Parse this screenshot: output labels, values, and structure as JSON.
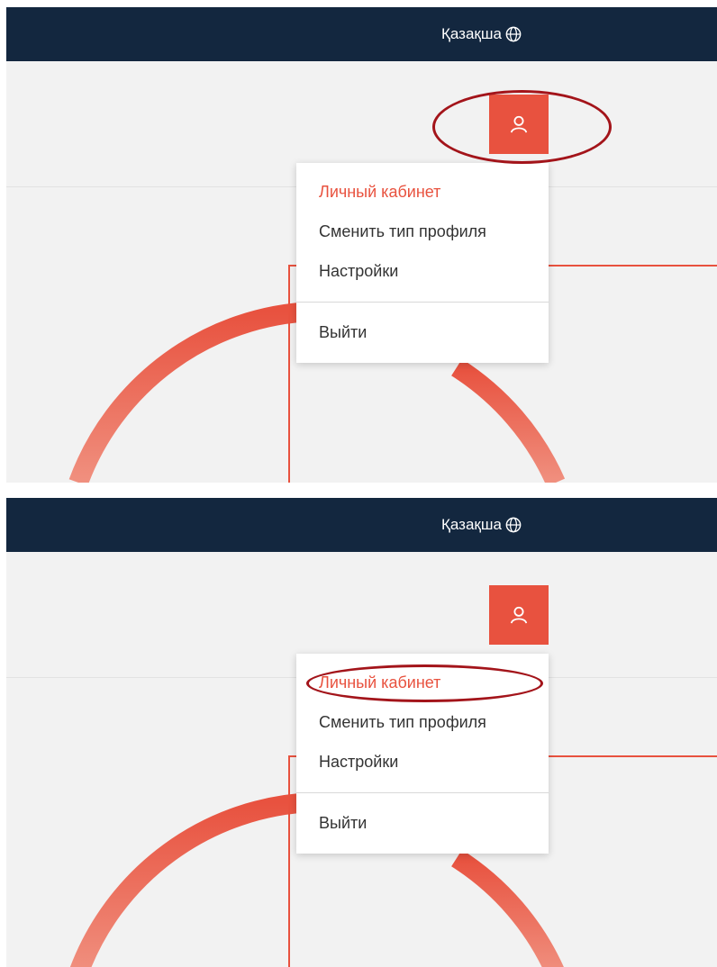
{
  "panels": [
    {
      "header": {
        "language_label": "Қазақша"
      },
      "user_button": {
        "icon": "user-icon"
      },
      "menu": {
        "items": [
          {
            "label": "Личный кабинет",
            "active": true
          },
          {
            "label": "Сменить тип профиля",
            "active": false
          },
          {
            "label": "Настройки",
            "active": false
          },
          {
            "label": "Выйти",
            "active": false
          }
        ]
      },
      "highlight": "user-button"
    },
    {
      "header": {
        "language_label": "Қазақша"
      },
      "user_button": {
        "icon": "user-icon"
      },
      "menu": {
        "items": [
          {
            "label": "Личный кабинет",
            "active": true
          },
          {
            "label": "Сменить тип профиля",
            "active": false
          },
          {
            "label": "Настройки",
            "active": false
          },
          {
            "label": "Выйти",
            "active": false
          }
        ]
      },
      "highlight": "menu-item-personal-cabinet"
    }
  ],
  "colors": {
    "header_bg": "#13273f",
    "accent": "#e8523f",
    "annotation": "#a3141a",
    "page_bg": "#f2f2f2"
  }
}
